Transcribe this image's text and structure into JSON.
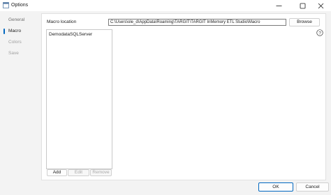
{
  "window": {
    "title": "Options"
  },
  "sidebar": {
    "items": [
      {
        "label": "General",
        "state": "normal"
      },
      {
        "label": "Macro",
        "state": "selected"
      },
      {
        "label": "Colors",
        "state": "disabled"
      },
      {
        "label": "Save",
        "state": "disabled"
      }
    ]
  },
  "macro": {
    "location_label": "Macro location",
    "location_value": "C:\\Users\\ole_d\\AppData\\Roaming\\TARGIT\\TARGIT InMemory ETL Studio\\Macro",
    "browse_label": "Browse",
    "list": [
      "DemodataSQLServer"
    ],
    "add_label": "Add",
    "edit_label": "Edit",
    "remove_label": "Remove"
  },
  "footer": {
    "ok_label": "OK",
    "cancel_label": "Cancel"
  },
  "colors": {
    "accent": "#0067c0",
    "background": "#f3f3f3",
    "panel": "#ffffff"
  },
  "icons": {
    "app": "app-icon",
    "minimize": "minimize-icon",
    "maximize": "maximize-icon",
    "close": "close-icon",
    "help": "help-icon"
  }
}
